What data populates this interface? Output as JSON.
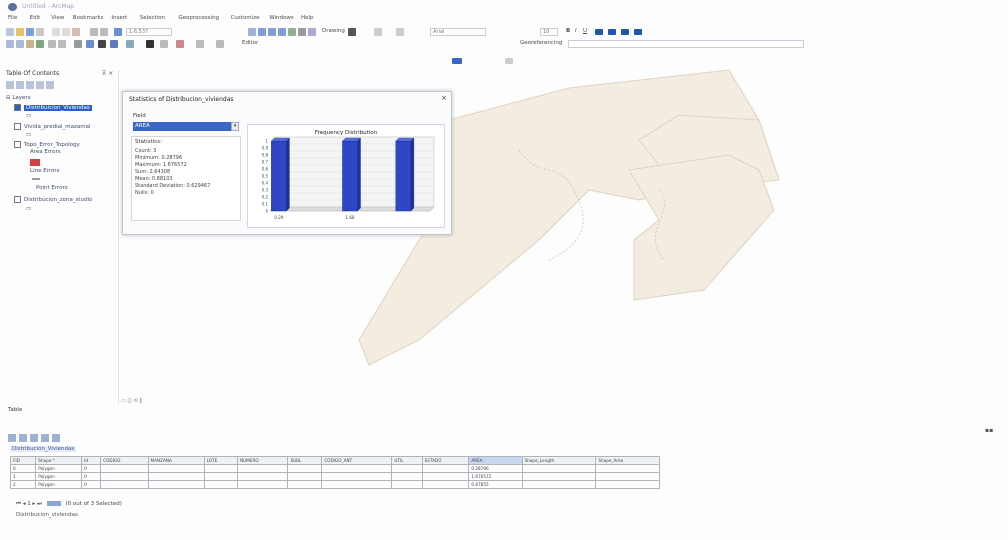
{
  "window": {
    "title": "Untitled - ArcMap"
  },
  "menu": [
    "File",
    "Edit",
    "View",
    "Bookmarks",
    "Insert",
    "Selection",
    "Geoprocessing",
    "Customize",
    "Windows",
    "Help"
  ],
  "toolbar": {
    "scale_field": "1:6,537",
    "drawing_label": "Drawing",
    "font_field": "Arial",
    "size_field": "10",
    "editor_label": "Editor",
    "georef_label": "Georeferencing"
  },
  "toc": {
    "title": "Table Of Contents",
    "layers_group": "Layers",
    "layers": [
      {
        "name": "Distribuicion_Viviendas",
        "checked": true,
        "selected": true
      },
      {
        "name": "Vivida_predial_mazamal",
        "checked": false
      },
      {
        "name": "Topo_Error_Topology",
        "checked": false
      },
      {
        "name": "Area Errors",
        "checked": false
      },
      {
        "name": "Line Errors",
        "checked": false
      },
      {
        "name": "Point Errors",
        "checked": false
      },
      {
        "name": "Distribucion_zona_studio",
        "checked": false
      }
    ]
  },
  "dialog": {
    "title": "Statistics of Distribucion_viviendas",
    "field_label": "Field",
    "field_value": "AREA",
    "stats_title": "Statistics:",
    "stats": [
      "Count:  3",
      "Minimum:  0.28796",
      "Maximum:  1.676572",
      "Sum:  2.64308",
      "Mean:  0.88103",
      "Standard Deviation:  0.629467",
      "Nulls:  0"
    ],
    "close_icon": "close-icon"
  },
  "chart_data": {
    "type": "bar",
    "title": "Frequency Distribution",
    "categories": [
      "0.29",
      "",
      "",
      "",
      "",
      "",
      "",
      "",
      "1.68"
    ],
    "values": [
      1,
      0,
      0,
      0,
      1,
      0,
      0,
      1,
      0
    ],
    "y_ticks": [
      "0",
      "0.1",
      "0.2",
      "0.3",
      "0.4",
      "0.5",
      "0.6",
      "0.7",
      "0.8",
      "0.9",
      "1"
    ],
    "ylim": [
      0,
      1
    ],
    "bar_color": "#2f47c4",
    "x_tick_labels": [
      "0.29",
      "1.68"
    ]
  },
  "table": {
    "panel_title": "Table",
    "tab_label": "Distribucion_Viviendas",
    "columns": [
      "FID",
      "Shape *",
      "Id",
      "CODIGO",
      "MANZANA",
      "LOTE",
      "NUMERO",
      "SUBL",
      "CODIGO_ANT",
      "UTIL",
      "ESTADO",
      "AREA",
      "Shape_Length",
      "Shape_Area"
    ],
    "rows": [
      [
        "0",
        "Polygon",
        "0",
        "",
        "",
        "",
        "",
        "",
        "",
        "",
        "",
        "0.28796",
        "",
        ""
      ],
      [
        "1",
        "Polygon",
        "0",
        "",
        "",
        "",
        "",
        "",
        "",
        "",
        "",
        "1.676572",
        "",
        ""
      ],
      [
        "2",
        "Polygon",
        "0",
        "",
        "",
        "",
        "",
        "",
        "",
        "",
        "",
        "0.67855",
        "",
        ""
      ]
    ],
    "nav": {
      "record": "1",
      "status": "(0 out of 3 Selected)"
    },
    "bottom_tab": "Distribucion_viviendas"
  },
  "colors": {
    "map_polygon": "#f2ece0",
    "map_outline": "#d8d0c0",
    "accent": "#2f5fc0"
  }
}
